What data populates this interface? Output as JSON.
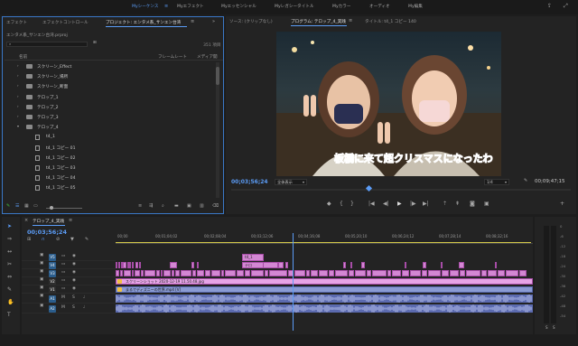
{
  "workspaces": {
    "items": [
      {
        "label": "Myシーケンス"
      },
      {
        "label": "Myエフェクト"
      },
      {
        "label": "Myエッセンシャル"
      },
      {
        "label": "Myレガシータイトル"
      },
      {
        "label": "Myカラー"
      },
      {
        "label": "オーディオ"
      },
      {
        "label": "My編集"
      }
    ]
  },
  "project": {
    "tabs": [
      {
        "label": "エフェクト"
      },
      {
        "label": "エフェクトコントロール"
      },
      {
        "label": "プロジェクト: エンタメ系_サンエン台湾"
      }
    ],
    "path": "エンタメ系_サンエン台湾.prproj",
    "item_count": "351 項目",
    "col_name": "名前",
    "col_framerate": "フレームレート",
    "col_media": "メディア開",
    "search_placeholder": "",
    "items": [
      {
        "label": "スクリーン_Effect",
        "type": "folder"
      },
      {
        "label": "スクリーン_場所",
        "type": "folder"
      },
      {
        "label": "スクリーン_断面",
        "type": "folder"
      },
      {
        "label": "テロップ_1",
        "type": "folder"
      },
      {
        "label": "テロップ_2",
        "type": "folder"
      },
      {
        "label": "テロップ_3",
        "type": "folder"
      },
      {
        "label": "テロップ_4",
        "type": "folder"
      },
      {
        "label": "t4_1",
        "type": "clip"
      },
      {
        "label": "t4_1 コピー 01",
        "type": "clip"
      },
      {
        "label": "t4_1 コピー 02",
        "type": "clip"
      },
      {
        "label": "t4_1 コピー 03",
        "type": "clip"
      },
      {
        "label": "t4_1 コピー 04",
        "type": "clip"
      },
      {
        "label": "t4_1 コピー 05",
        "type": "clip"
      }
    ]
  },
  "program": {
    "source_tab": "ソース: (クリップなし)",
    "program_tab": "プログラム: テロップ_4_実践",
    "title_tab": "タイトル: t4_1 コピー 140",
    "caption": "板橋に来て超クリスマスになったわ",
    "timecode": "00;03;56;24",
    "zoom": "全体表示",
    "quality": "1/4",
    "duration": "00;09;47;15"
  },
  "timeline": {
    "tab": "テロップ_4_実践",
    "timecode": "00;03;56;24",
    "ruler": [
      "00;00",
      "00;01;04;02",
      "00;02;08;04",
      "00;03;12;06",
      "00;04;16;08",
      "00;05;20;10",
      "00;06;24;12",
      "00;07;28;14",
      "00;08;32;16"
    ],
    "video_tracks": [
      "V5",
      "V4",
      "V3",
      "V2",
      "V1"
    ],
    "audio_tracks": [
      "A1",
      "A2"
    ],
    "clip_v2_label": "スクリーンショット 2020-12-19 11.50.48.jpg",
    "clip_v1_label": "まるでディズニーの世界.mp4 [V]",
    "clip_v4a": "t4_1",
    "clip_v4b": "テロ"
  },
  "meter": {
    "scale": [
      "0",
      "-6",
      "-12",
      "-18",
      "-24",
      "-30",
      "-36",
      "-42",
      "-48",
      "-54"
    ],
    "s_label": "S"
  },
  "colors": {
    "accent": "#5b9cf6",
    "clip_pink": "#d387d3",
    "clip_v1": "#8a9bd4",
    "audio": "#5c6bb0",
    "caption_fill": "#ff3b00"
  }
}
